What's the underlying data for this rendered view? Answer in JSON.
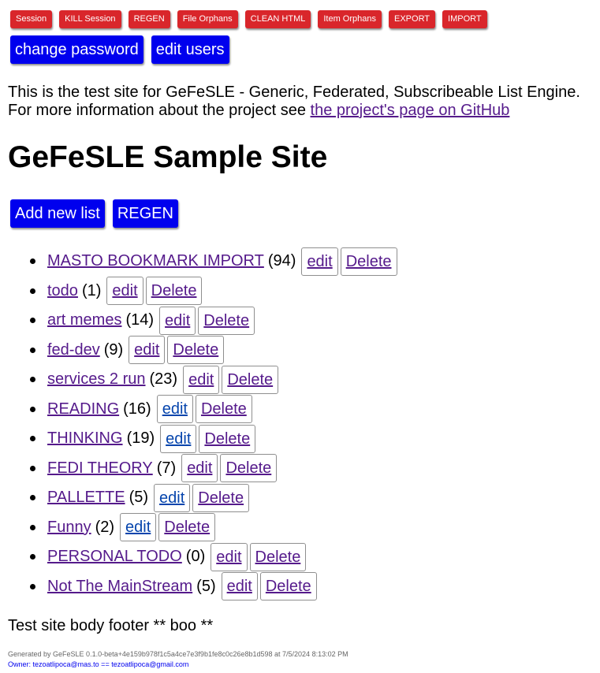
{
  "admin_buttons": [
    "Session",
    "KILL Session",
    "REGEN",
    "File Orphans",
    "CLEAN HTML",
    "Item Orphans",
    "EXPORT",
    "IMPORT"
  ],
  "user_buttons": {
    "change_password": "change password",
    "edit_users": "edit users"
  },
  "intro": {
    "line1": "This is the test site for GeFeSLE - Generic, Federated, Subscribeable List Engine.",
    "line2_prefix": "For more information about the project see ",
    "link_text": "the project's page on GitHub"
  },
  "site_title": "GeFeSLE Sample Site",
  "list_actions": {
    "add_new_list": "Add new list",
    "regen": "REGEN"
  },
  "lists": [
    {
      "name": "MASTO BOOKMARK IMPORT",
      "count": "(94)",
      "edit": "edit",
      "delete": "Delete",
      "edit_visited": true
    },
    {
      "name": "todo",
      "count": "(1)",
      "edit": "edit",
      "delete": "Delete",
      "edit_visited": true
    },
    {
      "name": "art memes",
      "count": "(14)",
      "edit": "edit",
      "delete": "Delete",
      "edit_visited": true
    },
    {
      "name": "fed-dev",
      "count": "(9)",
      "edit": "edit",
      "delete": "Delete",
      "edit_visited": true
    },
    {
      "name": "services 2 run",
      "count": "(23)",
      "edit": "edit",
      "delete": "Delete",
      "edit_visited": true
    },
    {
      "name": "READING",
      "count": "(16)",
      "edit": "edit",
      "delete": "Delete",
      "edit_visited": false
    },
    {
      "name": "THINKING",
      "count": "(19)",
      "edit": "edit",
      "delete": "Delete",
      "edit_visited": false
    },
    {
      "name": "FEDI THEORY",
      "count": "(7)",
      "edit": "edit",
      "delete": "Delete",
      "edit_visited": true
    },
    {
      "name": "PALLETTE",
      "count": "(5)",
      "edit": "edit",
      "delete": "Delete",
      "edit_visited": false
    },
    {
      "name": "Funny",
      "count": "(2)",
      "edit": "edit",
      "delete": "Delete",
      "edit_visited": false
    },
    {
      "name": "PERSONAL TODO",
      "count": "(0)",
      "edit": "edit",
      "delete": "Delete",
      "edit_visited": true
    },
    {
      "name": "Not The MainStream",
      "count": "(5)",
      "edit": "edit",
      "delete": "Delete",
      "edit_visited": true
    }
  ],
  "footer": {
    "body_text": "Test site body footer ** boo **",
    "generated": "Generated by GeFeSLE 0.1.0-beta+4e159b978f1c5a4ce7e3f9b1fe8c0c26e8b1d598 at 7/5/2024 8:13:02 PM",
    "owner": "Owner: tezoatlipoca@mas.to == tezoatlipoca@gmail.com"
  },
  "colors": {
    "admin_button_bg": "#d9262b",
    "primary_button_bg": "#0000ee",
    "visited_link": "#551a8b",
    "unvisited_link": "#0645ad"
  }
}
